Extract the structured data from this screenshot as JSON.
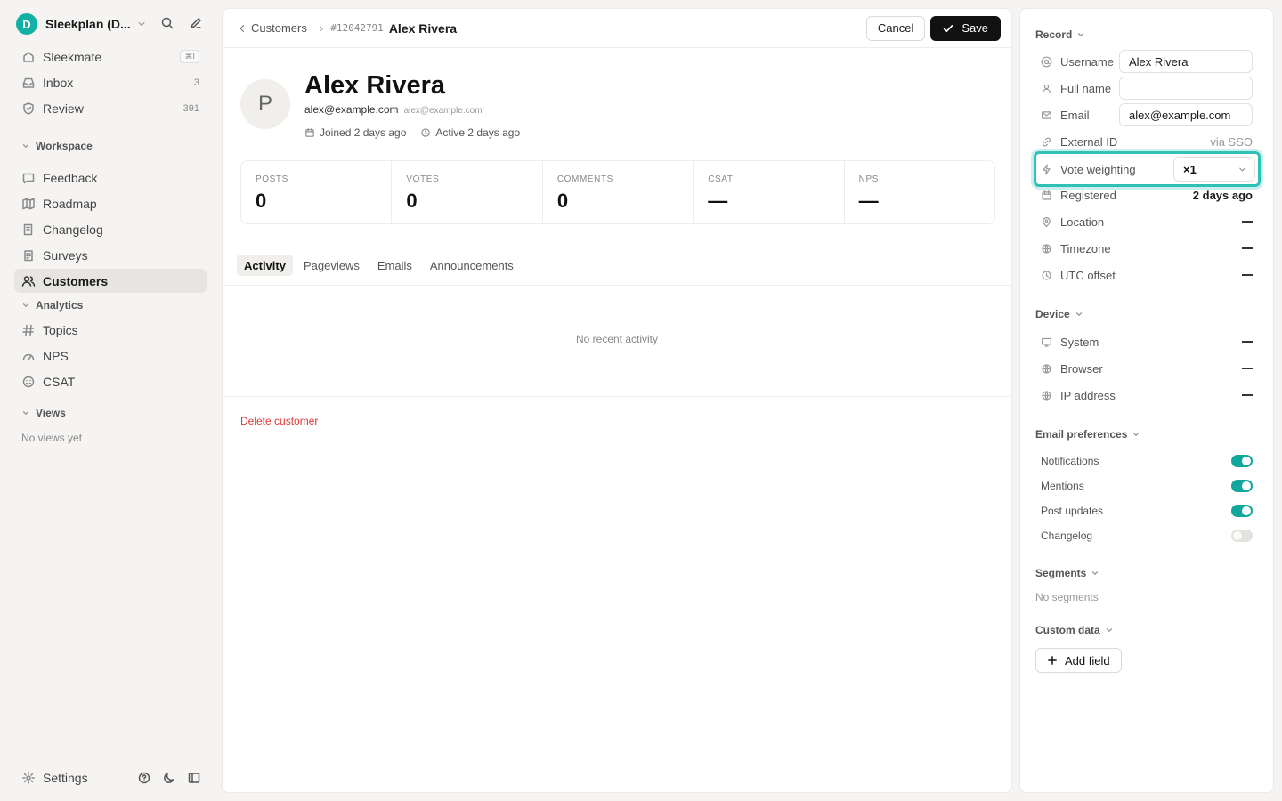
{
  "workspace": {
    "initial": "D",
    "name": "Sleekplan (D..."
  },
  "nav_main": [
    {
      "label": "Sleekmate",
      "icon": "sparkle-home-icon",
      "kbd": "⌘I",
      "count": ""
    },
    {
      "label": "Inbox",
      "icon": "inbox-icon",
      "kbd": "",
      "count": "3"
    },
    {
      "label": "Review",
      "icon": "shield-icon",
      "kbd": "",
      "count": "391"
    }
  ],
  "sections": {
    "workspace": "Workspace",
    "analytics": "Analytics",
    "views": "Views",
    "views_empty": "No views yet"
  },
  "nav_workspace": [
    {
      "label": "Feedback",
      "icon": "message-icon"
    },
    {
      "label": "Roadmap",
      "icon": "map-icon"
    },
    {
      "label": "Changelog",
      "icon": "book-icon"
    },
    {
      "label": "Surveys",
      "icon": "clipboard-icon"
    },
    {
      "label": "Customers",
      "icon": "users-icon",
      "active": true
    }
  ],
  "nav_analytics": [
    {
      "label": "Topics",
      "icon": "hash-icon"
    },
    {
      "label": "NPS",
      "icon": "gauge-icon"
    },
    {
      "label": "CSAT",
      "icon": "smile-icon"
    }
  ],
  "footer": {
    "settings": "Settings"
  },
  "topbar": {
    "back": "Customers",
    "record_id": "#12042791",
    "customer_name": "Alex Rivera",
    "cancel": "Cancel",
    "save": "Save"
  },
  "profile": {
    "initial": "P",
    "name": "Alex Rivera",
    "email": "alex@example.com",
    "email_alt": "alex@example.com",
    "joined": "Joined 2 days ago",
    "active": "Active 2 days ago"
  },
  "stats": [
    {
      "label": "POSTS",
      "value": "0"
    },
    {
      "label": "VOTES",
      "value": "0"
    },
    {
      "label": "COMMENTS",
      "value": "0"
    },
    {
      "label": "CSAT",
      "value": "—"
    },
    {
      "label": "NPS",
      "value": "—"
    }
  ],
  "tabs": [
    "Activity",
    "Pageviews",
    "Emails",
    "Announcements"
  ],
  "activity_empty": "No recent activity",
  "delete_label": "Delete customer",
  "record": {
    "title": "Record",
    "username_label": "Username",
    "username_value": "Alex Rivera",
    "fullname_label": "Full name",
    "fullname_value": "",
    "email_label": "Email",
    "email_value": "alex@example.com",
    "external_label": "External ID",
    "external_value": "via SSO",
    "vote_label": "Vote weighting",
    "vote_value": "×1",
    "registered_label": "Registered",
    "registered_value": "2 days ago",
    "location_label": "Location",
    "timezone_label": "Timezone",
    "utc_label": "UTC offset"
  },
  "device": {
    "title": "Device",
    "system_label": "System",
    "browser_label": "Browser",
    "ip_label": "IP address"
  },
  "email_prefs": {
    "title": "Email preferences",
    "items": [
      {
        "label": "Notifications",
        "on": true
      },
      {
        "label": "Mentions",
        "on": true
      },
      {
        "label": "Post updates",
        "on": true
      },
      {
        "label": "Changelog",
        "on": false
      }
    ]
  },
  "segments": {
    "title": "Segments",
    "empty": "No segments"
  },
  "custom_data": {
    "title": "Custom data",
    "add_field": "Add field"
  },
  "colors": {
    "accent": "#12b0a4",
    "highlight": "#2fc1b6",
    "danger": "#dc3a36",
    "toggle_on": "#12a79b"
  }
}
